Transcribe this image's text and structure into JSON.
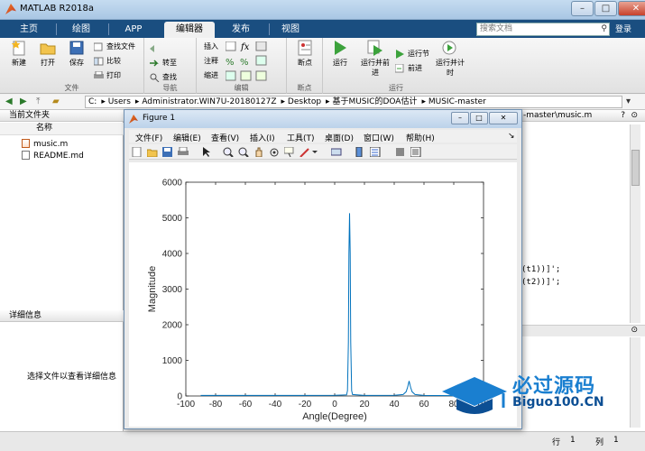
{
  "app": {
    "title": "MATLAB R2018a"
  },
  "tabs": [
    "主页",
    "绘图",
    "APP",
    "编辑器",
    "发布",
    "视图"
  ],
  "active_tab": "编辑器",
  "search": {
    "placeholder": "搜索文档"
  },
  "login": "登录",
  "ribbon": {
    "file": {
      "label": "文件",
      "new": "新建",
      "open": "打开",
      "save": "保存",
      "find_files": "查找文件",
      "compare": "比较",
      "print": "打印"
    },
    "navigate": {
      "label": "导航",
      "goto": "转至",
      "find": "查找"
    },
    "edit": {
      "label": "编辑",
      "insert": "插入",
      "comment": "注释",
      "indent": "缩进"
    },
    "breakpoints": {
      "label": "断点",
      "btn": "断点"
    },
    "run": {
      "label": "运行",
      "run": "运行",
      "run_advance": "运行并前进",
      "run_section": "运行节",
      "advance": "前进",
      "run_time": "运行并计时"
    }
  },
  "addressbar": {
    "segments": [
      "C:",
      "Users",
      "Administrator.WIN7U-20180127Z",
      "Desktop",
      "基于MUSIC的DOA估计",
      "MUSIC-master"
    ]
  },
  "current_folder": {
    "title": "当前文件夹",
    "column": "名称",
    "files": [
      "music.m",
      "README.md"
    ],
    "details_title": "详细信息",
    "details_msg": "选择文件以查看详细信息"
  },
  "editor_tab": "-master\\music.m",
  "code_frags": [
    "(t1))]';",
    "(t2))]';"
  ],
  "status": {
    "line_label": "行",
    "line": "1",
    "col_label": "列",
    "col": "1"
  },
  "figure": {
    "title": "Figure 1",
    "menu": [
      "文件(F)",
      "编辑(E)",
      "查看(V)",
      "插入(I)",
      "工具(T)",
      "桌面(D)",
      "窗口(W)",
      "帮助(H)"
    ]
  },
  "chart_data": {
    "type": "line",
    "xlabel": "Angle(Degree)",
    "ylabel": "Magnitude",
    "xlim": [
      -100,
      100
    ],
    "ylim": [
      0,
      6000
    ],
    "xticks": [
      -100,
      -80,
      -60,
      -40,
      -20,
      0,
      20,
      40,
      60,
      80,
      100
    ],
    "yticks": [
      0,
      1000,
      2000,
      3000,
      4000,
      5000,
      6000
    ],
    "series": [
      {
        "color": "#0072bd",
        "x": [
          -90,
          -20,
          0,
          8,
          8.6,
          9.2,
          9.6,
          10,
          10.4,
          10.8,
          11.4,
          12,
          20,
          40,
          46,
          48,
          49,
          50,
          51,
          52,
          54,
          60,
          80,
          90
        ],
        "y": [
          15,
          15,
          20,
          30,
          150,
          1500,
          4000,
          5130,
          4000,
          1500,
          150,
          40,
          15,
          20,
          40,
          120,
          250,
          420,
          250,
          120,
          40,
          15,
          10,
          10
        ]
      }
    ]
  },
  "watermark": {
    "cn": "必过源码",
    "en": "Biguo100.CN"
  },
  "colors": {
    "tabbar": "#1a4e80",
    "line": "#0072bd",
    "watermark": "#1a7fd0"
  }
}
